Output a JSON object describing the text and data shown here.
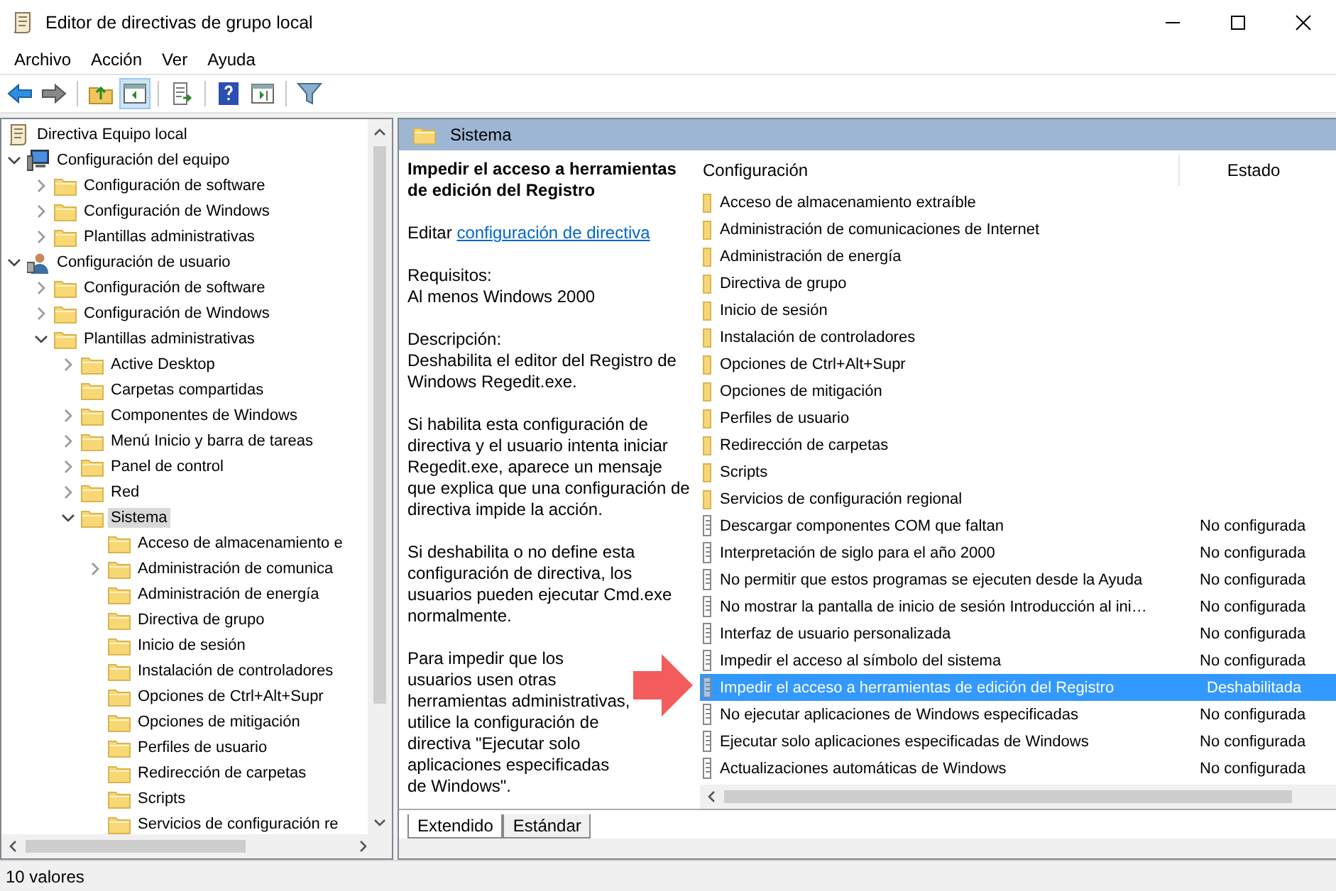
{
  "window": {
    "title": "Editor de directivas de grupo local"
  },
  "menu": [
    "Archivo",
    "Acción",
    "Ver",
    "Ayuda"
  ],
  "toolbar": [
    {
      "kind": "back",
      "pressed": false
    },
    {
      "kind": "forward",
      "pressed": false
    },
    {
      "kind": "sep"
    },
    {
      "kind": "up",
      "pressed": false
    },
    {
      "kind": "pane",
      "pressed": true
    },
    {
      "kind": "sep"
    },
    {
      "kind": "export",
      "pressed": false
    },
    {
      "kind": "sep"
    },
    {
      "kind": "help",
      "pressed": false
    },
    {
      "kind": "props",
      "pressed": false
    },
    {
      "kind": "sep"
    },
    {
      "kind": "filter",
      "pressed": false
    }
  ],
  "tree": [
    {
      "kind": "scroll",
      "label": "Directiva Equipo local",
      "selected": false,
      "children": [
        {
          "kind": "computer",
          "label": "Configuración del equipo",
          "expanded": true,
          "selected": false,
          "children": [
            {
              "kind": "folder",
              "label": "Configuración de software",
              "expanded": false,
              "selected": false
            },
            {
              "kind": "folder",
              "label": "Configuración de Windows",
              "expanded": false,
              "selected": false
            },
            {
              "kind": "folder",
              "label": "Plantillas administrativas",
              "expanded": false,
              "selected": false
            }
          ]
        },
        {
          "kind": "user",
          "label": "Configuración de usuario",
          "expanded": true,
          "selected": false,
          "children": [
            {
              "kind": "folder",
              "label": "Configuración de software",
              "expanded": false,
              "selected": false
            },
            {
              "kind": "folder",
              "label": "Configuración de Windows",
              "expanded": false,
              "selected": false
            },
            {
              "kind": "folder",
              "label": "Plantillas administrativas",
              "expanded": true,
              "selected": false,
              "children": [
                {
                  "kind": "folder",
                  "label": "Active Desktop",
                  "expanded": false,
                  "selected": false
                },
                {
                  "kind": "folder",
                  "label": "Carpetas compartidas",
                  "selected": false
                },
                {
                  "kind": "folder",
                  "label": "Componentes de Windows",
                  "expanded": false,
                  "selected": false
                },
                {
                  "kind": "folder",
                  "label": "Menú Inicio y barra de tareas",
                  "expanded": false,
                  "selected": false
                },
                {
                  "kind": "folder",
                  "label": "Panel de control",
                  "expanded": false,
                  "selected": false
                },
                {
                  "kind": "folder",
                  "label": "Red",
                  "expanded": false,
                  "selected": false
                },
                {
                  "kind": "folder",
                  "label": "Sistema",
                  "expanded": true,
                  "selected": true,
                  "children": [
                    {
                      "kind": "folder",
                      "label": "Acceso de almacenamiento e",
                      "selected": false
                    },
                    {
                      "kind": "folder",
                      "label": "Administración de comunica",
                      "expanded": false,
                      "selected": false
                    },
                    {
                      "kind": "folder",
                      "label": "Administración de energía",
                      "selected": false
                    },
                    {
                      "kind": "folder",
                      "label": "Directiva de grupo",
                      "selected": false
                    },
                    {
                      "kind": "folder",
                      "label": "Inicio de sesión",
                      "selected": false
                    },
                    {
                      "kind": "folder",
                      "label": "Instalación de controladores",
                      "selected": false
                    },
                    {
                      "kind": "folder",
                      "label": "Opciones de Ctrl+Alt+Supr",
                      "selected": false
                    },
                    {
                      "kind": "folder",
                      "label": "Opciones de mitigación",
                      "selected": false
                    },
                    {
                      "kind": "folder",
                      "label": "Perfiles de usuario",
                      "selected": false
                    },
                    {
                      "kind": "folder",
                      "label": "Redirección de carpetas",
                      "selected": false
                    },
                    {
                      "kind": "folder",
                      "label": "Scripts",
                      "selected": false
                    },
                    {
                      "kind": "folder",
                      "label": "Servicios de configuración re",
                      "selected": false
                    }
                  ]
                }
              ]
            }
          ]
        }
      ]
    }
  ],
  "pane_header": "Sistema",
  "description": {
    "title": "Impedir el acceso a herramientas de edición del Registro",
    "edit_prefix": "Editar",
    "edit_link": "configuración de directiva",
    "paragraphs": [
      "Requisitos:\nAl menos Windows 2000",
      "Descripción:\nDeshabilita el editor del Registro de Windows Regedit.exe.",
      "Si habilita esta configuración de directiva y el usuario intenta iniciar Regedit.exe, aparece un mensaje que explica que una configuración de directiva impide la acción.",
      "Si deshabilita o no define esta configuración de directiva, los usuarios pueden ejecutar Cmd.exe normalmente.",
      "Para impedir que los usuarios usen otras herramientas administrativas, utilice la configuración de directiva \"Ejecutar solo aplicaciones especificadas de Windows\"."
    ]
  },
  "list": {
    "columns": [
      "Configuración",
      "Estado"
    ],
    "rows": [
      {
        "kind": "folder",
        "name": "Acceso de almacenamiento extraíble",
        "selected": false
      },
      {
        "kind": "folder",
        "name": "Administración de comunicaciones de Internet",
        "selected": false
      },
      {
        "kind": "folder",
        "name": "Administración de energía",
        "selected": false
      },
      {
        "kind": "folder",
        "name": "Directiva de grupo",
        "selected": false
      },
      {
        "kind": "folder",
        "name": "Inicio de sesión",
        "selected": false
      },
      {
        "kind": "folder",
        "name": "Instalación de controladores",
        "selected": false
      },
      {
        "kind": "folder",
        "name": "Opciones de Ctrl+Alt+Supr",
        "selected": false
      },
      {
        "kind": "folder",
        "name": "Opciones de mitigación",
        "selected": false
      },
      {
        "kind": "folder",
        "name": "Perfiles de usuario",
        "selected": false
      },
      {
        "kind": "folder",
        "name": "Redirección de carpetas",
        "selected": false
      },
      {
        "kind": "folder",
        "name": "Scripts",
        "selected": false
      },
      {
        "kind": "folder",
        "name": "Servicios de configuración regional",
        "selected": false
      },
      {
        "kind": "setting",
        "name": "Descargar componentes COM que faltan",
        "state": "No configurada",
        "selected": false
      },
      {
        "kind": "setting",
        "name": "Interpretación de siglo para el año 2000",
        "state": "No configurada",
        "selected": false
      },
      {
        "kind": "setting",
        "name": "No permitir que estos programas se ejecuten desde la Ayuda",
        "state": "No configurada",
        "selected": false
      },
      {
        "kind": "setting",
        "name": "No mostrar la pantalla de inicio de sesión Introducción al ini…",
        "state": "No configurada",
        "selected": false
      },
      {
        "kind": "setting",
        "name": "Interfaz de usuario personalizada",
        "state": "No configurada",
        "selected": false
      },
      {
        "kind": "setting",
        "name": "Impedir el acceso al símbolo del sistema",
        "state": "No configurada",
        "selected": false
      },
      {
        "kind": "setting",
        "name": "Impedir el acceso a herramientas de edición del Registro",
        "state": "Deshabilitada",
        "selected": true
      },
      {
        "kind": "setting",
        "name": "No ejecutar aplicaciones de Windows especificadas",
        "state": "No configurada",
        "selected": false
      },
      {
        "kind": "setting",
        "name": "Ejecutar solo aplicaciones especificadas de Windows",
        "state": "No configurada",
        "selected": false
      },
      {
        "kind": "setting",
        "name": "Actualizaciones automáticas de Windows",
        "state": "No configurada",
        "selected": false
      }
    ]
  },
  "tabs": [
    {
      "label": "Extendido",
      "selected": true
    },
    {
      "label": "Estándar",
      "selected": false
    }
  ],
  "status_bar": "10 valores"
}
